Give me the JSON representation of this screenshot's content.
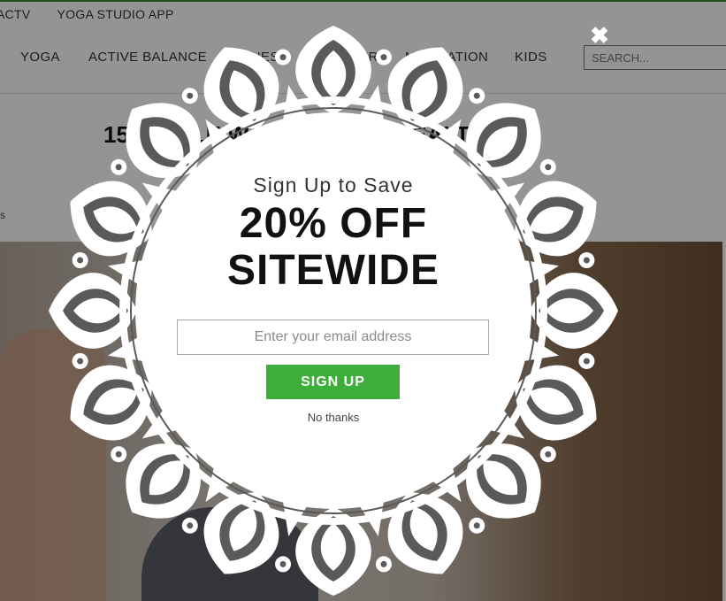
{
  "top_bar": {
    "items": [
      "ACTV",
      "YOGA STUDIO APP"
    ]
  },
  "nav": {
    "items": [
      "YOGA",
      "ACTIVE BALANCE",
      "FITNESS",
      "HEALTHIER",
      "MEDITATION",
      "KIDS"
    ],
    "search_placeholder": "SEARCH..."
  },
  "article": {
    "headline": "15 SIMPLE WAYS TO LIVE HEALTHIER",
    "crumb_fragment": "s"
  },
  "popup": {
    "subtitle": "Sign Up to Save",
    "headline_line1": "20% OFF",
    "headline_line2": "SITEWIDE",
    "email_placeholder": "Enter your email address",
    "signup_label": "SIGN UP",
    "no_thanks_label": "No thanks",
    "close_symbol": "✖",
    "close_icon": "close-icon"
  },
  "colors": {
    "accent_green": "#3eae3a",
    "header_border": "#3a8b2f"
  }
}
